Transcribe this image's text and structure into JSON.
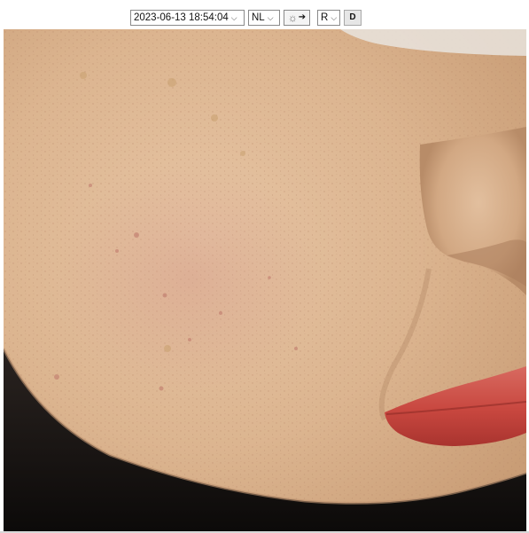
{
  "toolbar": {
    "datetime": "2023-06-13 18:54:04",
    "mode": "NL",
    "light_icon": "sun-icon",
    "light_arrow": "➔",
    "side": "R",
    "d_label": "D"
  },
  "photo": {
    "subject_icon": "face-skin-closeup",
    "colors": {
      "skin": "#dcb38f",
      "shadow": "#1a1614",
      "lip": "#c8473f"
    }
  }
}
